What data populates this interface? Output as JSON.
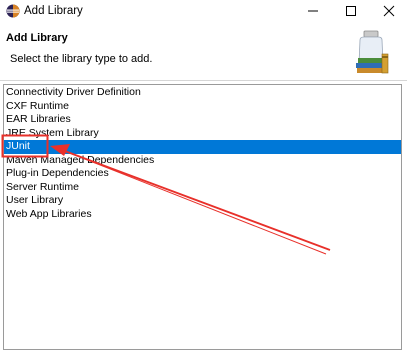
{
  "window": {
    "title": "Add Library"
  },
  "header": {
    "title": "Add Library",
    "description": "Select the library type to add."
  },
  "library_types": [
    "Connectivity Driver Definition",
    "CXF Runtime",
    "EAR Libraries",
    "JRE System Library",
    "JUnit",
    "Maven Managed Dependencies",
    "Plug-in Dependencies",
    "Server Runtime",
    "User Library",
    "Web App Libraries"
  ],
  "selected_index": 4,
  "colors": {
    "selection": "#0078d7",
    "annotation": "#e8302a"
  }
}
